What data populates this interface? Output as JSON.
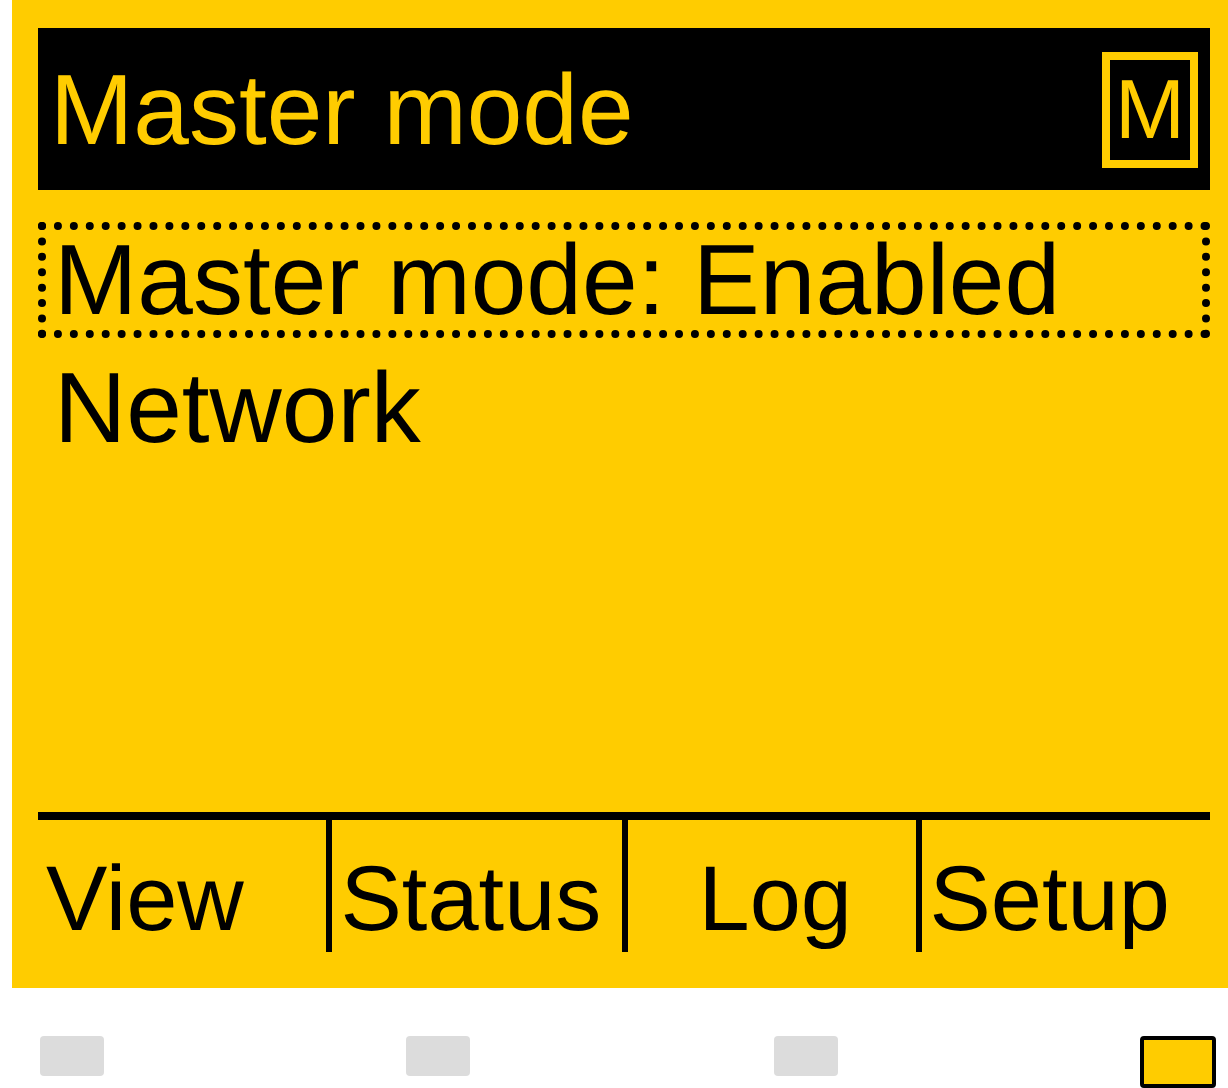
{
  "header": {
    "title": "Master mode",
    "badge": "M"
  },
  "menu_items": [
    {
      "label": "Master mode: Enabled",
      "selected": true
    },
    {
      "label": "Network",
      "selected": false
    }
  ],
  "softkeys": [
    "View",
    "Status",
    "Log",
    "Setup"
  ],
  "leds": [
    {
      "on": false
    },
    {
      "on": false
    },
    {
      "on": false
    },
    {
      "on": true
    }
  ]
}
